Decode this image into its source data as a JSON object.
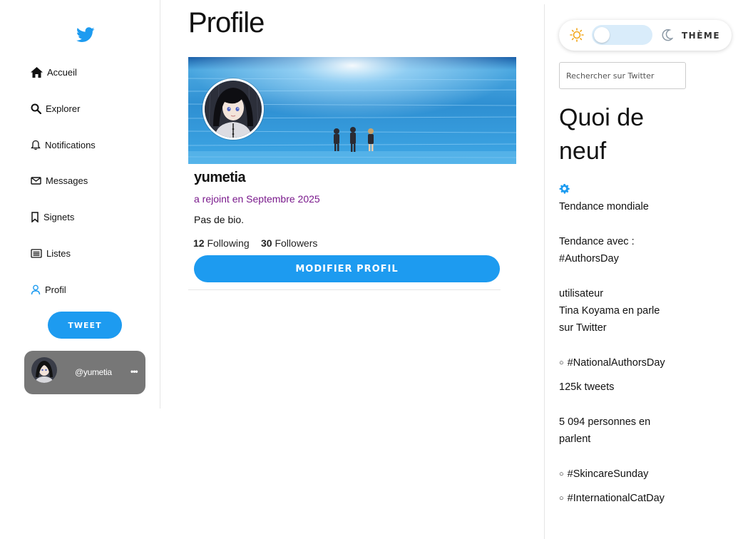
{
  "sidebar": {
    "logo_icon": "twitter-bird-icon",
    "brand_color": "#1d9bf0",
    "items": [
      {
        "label": "Accueil",
        "icon": "home-icon"
      },
      {
        "label": "Explorer",
        "icon": "search-icon"
      },
      {
        "label": "Notifications",
        "icon": "bell-icon"
      },
      {
        "label": "Messages",
        "icon": "envelope-icon"
      },
      {
        "label": "Signets",
        "icon": "bookmark-icon"
      },
      {
        "label": "Listes",
        "icon": "list-icon"
      },
      {
        "label": "Profil",
        "icon": "user-icon"
      }
    ],
    "tweet_label": "TWEET",
    "user_card": {
      "handle": "@yumetia",
      "more": "•••"
    }
  },
  "main": {
    "title": "Profile",
    "profile": {
      "name": "yumetia",
      "joined": "a rejoint en Septembre 2025",
      "bio": "Pas de bio.",
      "following_count": "12",
      "following_label": "Following",
      "followers_count": "30",
      "followers_label": "Followers",
      "edit_label": "MODIFIER PROFIL"
    }
  },
  "right": {
    "theme_label": "THÈME",
    "search_placeholder": "Rechercher sur Twitter",
    "section_title": "Quoi de neuf",
    "trends": {
      "worldwide": "Tendance mondiale",
      "trending_with": "Tendance avec :",
      "trending_tag": "#AuthorsDay",
      "user_label": "utilisateur",
      "user_line1": "Tina Koyama en parle",
      "user_line2": "sur Twitter",
      "tag1": "#NationalAuthorsDay",
      "tag1_count": "125k tweets",
      "people_line1": "5 094 personnes en",
      "people_line2": "parlent",
      "tag2": "#SkincareSunday",
      "tag3": "#InternationalCatDay",
      "bullet": "○"
    }
  }
}
